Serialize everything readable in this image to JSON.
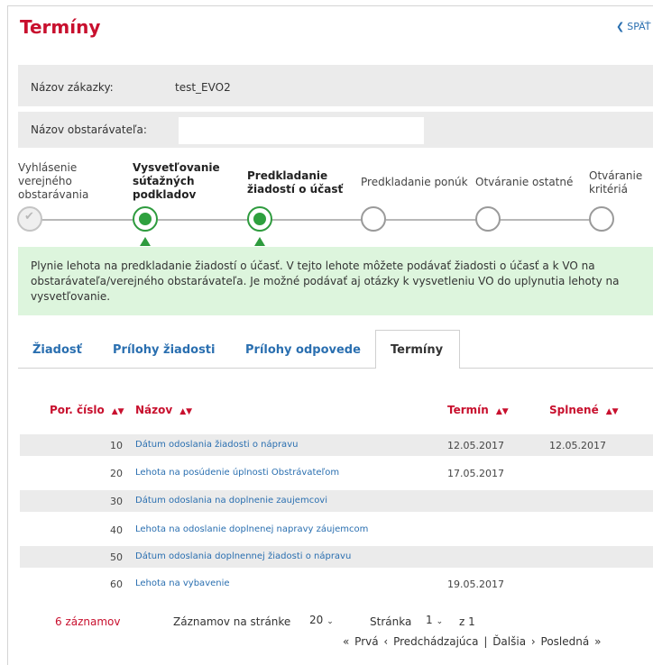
{
  "header": {
    "title": "Termíny",
    "back_label": "SPÄŤ"
  },
  "fields": [
    {
      "label": "Názov zákazky:",
      "value": "test_EVO2"
    },
    {
      "label": "Názov obstarávateľa:",
      "value": ""
    }
  ],
  "steps": [
    {
      "label_lines": [
        "Vyhlásenie",
        "verejného",
        "obstarávania"
      ],
      "state": "done"
    },
    {
      "label_lines": [
        "Vysvetľovanie",
        "súťažných",
        "podkladov"
      ],
      "state": "active"
    },
    {
      "label_lines": [
        "Predkladanie",
        "žiadostí o účasť"
      ],
      "state": "active"
    },
    {
      "label_lines": [
        "Predkladanie ponúk"
      ],
      "state": "pending"
    },
    {
      "label_lines": [
        "Otváranie ostatné"
      ],
      "state": "pending"
    },
    {
      "label_lines": [
        "Otváranie",
        "kritériá"
      ],
      "state": "pending"
    }
  ],
  "info_message": "Plynie lehota na predkladanie žiadostí o účasť. V tejto lehote môžete podávať žiadosti o účasť a k VO na obstarávateľa/verejného obstarávateľa. Je možné podávať aj otázky k vysvetleniu VO do uplynutia lehoty na vysvetľovanie.",
  "tabs": [
    {
      "label": "Žiadosť",
      "active": false
    },
    {
      "label": "Prílohy žiadosti",
      "active": false
    },
    {
      "label": "Prílohy odpovede",
      "active": false
    },
    {
      "label": "Termíny",
      "active": true
    }
  ],
  "table": {
    "columns": [
      "Por. číslo",
      "Názov",
      "Termín",
      "Splnené"
    ],
    "rows": [
      {
        "num": "10",
        "name": "Dátum odoslania žiadosti o nápravu",
        "due": "12.05.2017",
        "done": "12.05.2017"
      },
      {
        "num": "20",
        "name": "Lehota na posúdenie úplnosti Obstrávateľom",
        "due": "17.05.2017",
        "done": ""
      },
      {
        "num": "30",
        "name": "Dátum odoslania na doplnenie zaujemcovi",
        "due": "",
        "done": ""
      },
      {
        "num": "40",
        "name": "Lehota na odoslanie doplnenej napravy záujemcom",
        "due": "",
        "done": ""
      },
      {
        "num": "50",
        "name": "Dátum odoslania doplnennej žiadosti o nápravu",
        "due": "",
        "done": ""
      },
      {
        "num": "60",
        "name": "Lehota na vybavenie",
        "due": "19.05.2017",
        "done": ""
      }
    ]
  },
  "footer": {
    "count": "6 záznamov",
    "per_page_label": "Záznamov na stránke",
    "per_page_value": "20",
    "page_label": "Stránka",
    "page_value": "1",
    "page_of": "z 1",
    "first": "Prvá",
    "prev": "Predchádzajúca",
    "sep": "|",
    "next": "Ďalšia",
    "last": "Posledná"
  },
  "colors": {
    "accent_red": "#c8102e",
    "link_blue": "#2a6fb0",
    "active_green": "#2ea03e",
    "info_bg": "#ddf5dd"
  }
}
